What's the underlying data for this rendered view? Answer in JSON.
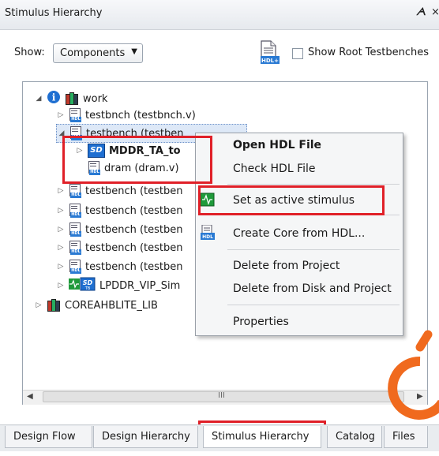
{
  "window": {
    "title": "Stimulus Hierarchy",
    "pin_glyph": "ᗅ",
    "close_glyph": "×"
  },
  "toolbar": {
    "show_label": "Show:",
    "show_value": "Components",
    "root_testbenches_label": "Show Root Testbenches",
    "root_testbenches_checked": false
  },
  "tree": {
    "items": [
      {
        "label": "work",
        "icon": "info-library-icon"
      },
      {
        "label": "testbnch (testbnch.v)",
        "icon": "hdl-file-icon"
      },
      {
        "label": "testbench (testben",
        "icon": "hdl-file-icon"
      },
      {
        "label": "MDDR_TA_to",
        "icon": "smartdesign-icon"
      },
      {
        "label": "dram (dram.v)",
        "icon": "hdl-file-icon"
      },
      {
        "label": "testbench (testben",
        "icon": "hdl-file-icon"
      },
      {
        "label": "testbench (testben",
        "icon": "hdl-file-icon"
      },
      {
        "label": "testbench (testben",
        "icon": "hdl-file-icon"
      },
      {
        "label": "testbench (testben",
        "icon": "hdl-file-icon"
      },
      {
        "label": "testbench (testben",
        "icon": "hdl-file-icon"
      },
      {
        "label": "LPDDR_VIP_Sim",
        "icon": "smartdesign-tb-icon"
      },
      {
        "label": "COREAHBLITE_LIB",
        "icon": "library-icon"
      }
    ],
    "scroll_grip": "III"
  },
  "context_menu": {
    "items": [
      {
        "label": "Open HDL File",
        "bold": true
      },
      {
        "label": "Check HDL File"
      },
      {
        "label": "Set as active stimulus"
      },
      {
        "label": "Create Core from HDL..."
      },
      {
        "label": "Delete from Project"
      },
      {
        "label": "Delete from Disk and Project"
      },
      {
        "label": "Properties"
      }
    ]
  },
  "tabs": [
    {
      "label": "Design Flow"
    },
    {
      "label": "Design Hierarchy"
    },
    {
      "label": "Stimulus Hierarchy",
      "active": true
    },
    {
      "label": "Catalog"
    },
    {
      "label": "Files"
    }
  ],
  "colors": {
    "highlight": "#e02028",
    "selection": "#dde8f7",
    "accent": "#1f6fd1",
    "watermark": "#f06a1e"
  }
}
